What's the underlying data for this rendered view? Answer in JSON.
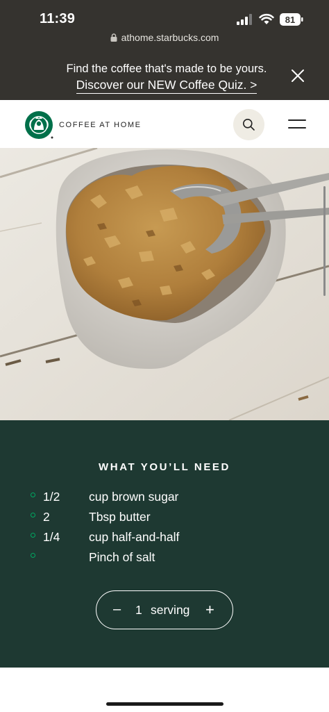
{
  "status_bar": {
    "time": "11:39",
    "battery": "81"
  },
  "browser": {
    "url": "athome.starbucks.com"
  },
  "promo": {
    "line1": "Find the coffee that's made to be yours.",
    "link": "Discover our NEW Coffee Quiz. >"
  },
  "header": {
    "brand": "COFFEE AT HOME"
  },
  "hero": {
    "image_subject": "brown sugar in a ceramic cup with a measuring spoon"
  },
  "recipe": {
    "title": "WHAT YOU’LL NEED",
    "ingredients": [
      {
        "qty": "1/2",
        "desc": "cup brown sugar"
      },
      {
        "qty": "2",
        "desc": "Tbsp butter"
      },
      {
        "qty": "1/4",
        "desc": "cup half-and-half"
      },
      {
        "qty": "",
        "desc": "Pinch of salt"
      }
    ],
    "servings": {
      "minus": "–",
      "count": "1",
      "unit": "serving",
      "plus": "+"
    }
  },
  "colors": {
    "brand_green": "#1e3932",
    "accent_green": "#00a862",
    "promo_bg": "#35332f"
  }
}
